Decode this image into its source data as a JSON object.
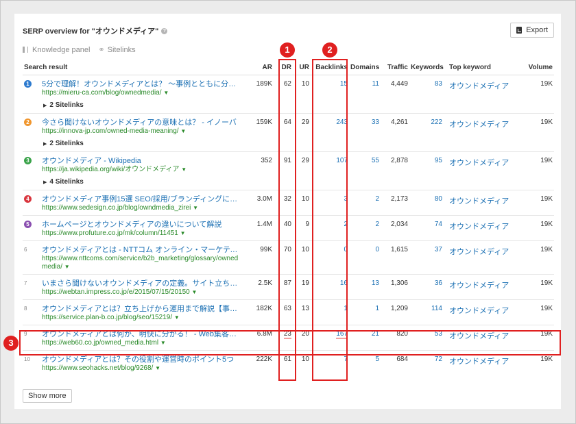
{
  "header": {
    "title": "SERP overview for \"オウンドメディア\"",
    "help_icon": "?",
    "export_label": "Export"
  },
  "filters": [
    {
      "label": "Knowledge panel",
      "icon": "knowledge-panel-icon"
    },
    {
      "label": "Sitelinks",
      "icon": "link-icon"
    }
  ],
  "columns": [
    "Search result",
    "AR",
    "DR",
    "UR",
    "Backlinks",
    "Domains",
    "Traffic",
    "Keywords",
    "Top keyword",
    "Volume"
  ],
  "results": [
    {
      "pos": "1",
      "pos_color": "#2e7bcf",
      "title": "5分で理解！オウンドメディアとは？ 〜事例とともに分かり ...",
      "url": "https://mieru-ca.com/blog/ownedmedia/",
      "ar": "189K",
      "dr": "62",
      "ur": "10",
      "backlinks": "15",
      "domains": "11",
      "traffic": "4,449",
      "keywords": "83",
      "top_keyword": "オウンドメディア",
      "volume": "19K",
      "sitelinks": "2 Sitelinks"
    },
    {
      "pos": "2",
      "pos_color": "#f0962e",
      "title": "今さら聞けないオウンドメディアの意味とは？ - イノーバ",
      "url": "https://innova-jp.com/owned-media-meaning/",
      "ar": "159K",
      "dr": "64",
      "ur": "29",
      "backlinks": "243",
      "domains": "33",
      "traffic": "4,261",
      "keywords": "222",
      "top_keyword": "オウンドメディア",
      "volume": "19K",
      "sitelinks": "2 Sitelinks"
    },
    {
      "pos": "3",
      "pos_color": "#3aa34a",
      "title": "オウンドメディア - Wikipedia",
      "url": "https://ja.wikipedia.org/wiki/オウンドメディア",
      "ar": "352",
      "dr": "91",
      "ur": "29",
      "backlinks": "107",
      "domains": "55",
      "traffic": "2,878",
      "keywords": "95",
      "top_keyword": "オウンドメディア",
      "volume": "19K",
      "sitelinks": "4 Sitelinks"
    },
    {
      "pos": "4",
      "pos_color": "#d9363e",
      "title": "オウンドメディア事例15選 SEO/採用/ブランディングに効く！",
      "url": "https://www.sedesign.co.jp/blog/owndmedia_zirei",
      "ar": "3.0M",
      "dr": "32",
      "ur": "10",
      "backlinks": "3",
      "domains": "2",
      "traffic": "2,173",
      "keywords": "80",
      "top_keyword": "オウンドメディア",
      "volume": "19K",
      "sitelinks": ""
    },
    {
      "pos": "5",
      "pos_color": "#8a4fb0",
      "title": "ホームページとオウンドメディアの違いについて解説",
      "url": "https://www.profuture.co.jp/mk/column/11451",
      "ar": "1.4M",
      "dr": "40",
      "ur": "9",
      "backlinks": "2",
      "domains": "2",
      "traffic": "2,034",
      "keywords": "74",
      "top_keyword": "オウンドメディア",
      "volume": "19K",
      "sitelinks": ""
    },
    {
      "pos": "6",
      "pos_color": "",
      "title": "オウンドメディアとは - NTTコム オンライン・マーケティング ...",
      "url": "https://www.nttcoms.com/service/b2b_marketing/glossary/ownedmedia/",
      "ar": "99K",
      "dr": "70",
      "ur": "10",
      "backlinks": "0",
      "domains": "0",
      "traffic": "1,615",
      "keywords": "37",
      "top_keyword": "オウンドメディア",
      "volume": "19K",
      "sitelinks": ""
    },
    {
      "pos": "7",
      "pos_color": "",
      "title": "いまさら聞けないオウンドメディアの定義。サイト立ち上げ前 ...",
      "url": "https://webtan.impress.co.jp/e/2015/07/15/20150",
      "ar": "2.5K",
      "dr": "87",
      "ur": "19",
      "backlinks": "16",
      "domains": "13",
      "traffic": "1,306",
      "keywords": "36",
      "top_keyword": "オウンドメディア",
      "volume": "19K",
      "sitelinks": ""
    },
    {
      "pos": "8",
      "pos_color": "",
      "title": "オウンドメディアとは？立ち上げから運用まで解説【事例アリ】",
      "url": "https://service.plan-b.co.jp/blog/seo/15219/",
      "ar": "182K",
      "dr": "63",
      "ur": "13",
      "backlinks": "1",
      "domains": "1",
      "traffic": "1,209",
      "keywords": "114",
      "top_keyword": "オウンドメディア",
      "volume": "19K",
      "sitelinks": ""
    },
    {
      "pos": "9",
      "pos_color": "",
      "title": "オウンドメディアとは何か、明快に分かる！ - Web集客の ...",
      "url": "https://web60.co.jp/owned_media.html",
      "ar": "6.8M",
      "dr": "23",
      "ur": "20",
      "backlinks": "167",
      "domains": "21",
      "traffic": "820",
      "keywords": "53",
      "top_keyword": "オウンドメディア",
      "volume": "19K",
      "sitelinks": ""
    },
    {
      "pos": "10",
      "pos_color": "",
      "title": "オウンドメディアとは？その役割や運営時のポイント5つ",
      "url": "https://www.seohacks.net/blog/9268/",
      "ar": "222K",
      "dr": "61",
      "ur": "10",
      "backlinks": "7",
      "domains": "5",
      "traffic": "684",
      "keywords": "72",
      "top_keyword": "オウンドメディア",
      "volume": "19K",
      "sitelinks": ""
    }
  ],
  "show_more_label": "Show more",
  "annotations": [
    "1",
    "2",
    "3"
  ],
  "colors": {
    "link": "#1a6fb3",
    "url": "#2a8a2a",
    "annotation": "#e02020"
  }
}
